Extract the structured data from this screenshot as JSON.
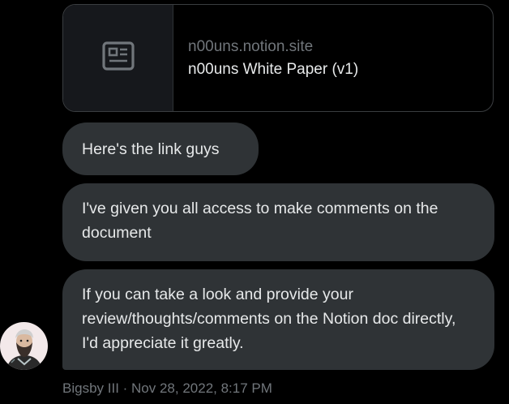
{
  "link_card": {
    "icon": "article-icon",
    "domain": "n00uns.notion.site",
    "title": "n00uns White Paper (v1)"
  },
  "messages": [
    {
      "text": "Here's the link guys"
    },
    {
      "text": "I've given you all access to make comments on the document"
    },
    {
      "text": "If you can take a look and provide your review/thoughts/comments on the Notion doc directly, I'd appreciate it greatly."
    }
  ],
  "sender": {
    "avatar_icon": "avatar",
    "meta": "Bigsby III · Nov 28, 2022, 8:17 PM"
  },
  "colors": {
    "background": "#000000",
    "bubble": "#2f3336",
    "text": "#e7e9ea",
    "muted": "#71767b"
  }
}
